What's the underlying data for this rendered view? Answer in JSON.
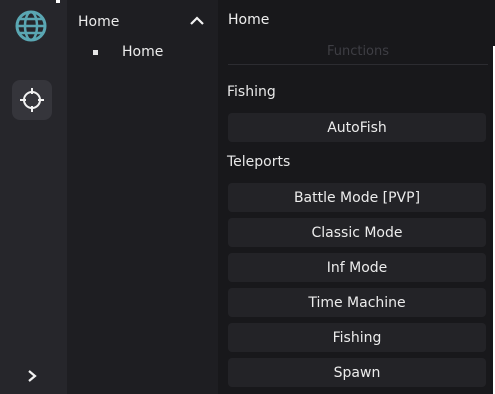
{
  "sidebar": {
    "icons": {
      "logo": "globe-icon",
      "target": "crosshair-icon",
      "expand": "chevron-right-icon"
    },
    "accent": "#5aa7b3"
  },
  "nav": {
    "header": "Home",
    "items": [
      {
        "label": "Home"
      }
    ]
  },
  "main": {
    "title": "Home",
    "section_title": "Functions",
    "groups": [
      {
        "label": "Fishing",
        "buttons": [
          "AutoFish"
        ]
      },
      {
        "label": "Teleports",
        "buttons": [
          "Battle Mode [PVP]",
          "Classic Mode",
          "Inf Mode",
          "Time Machine",
          "Fishing",
          "Spawn"
        ]
      }
    ]
  }
}
